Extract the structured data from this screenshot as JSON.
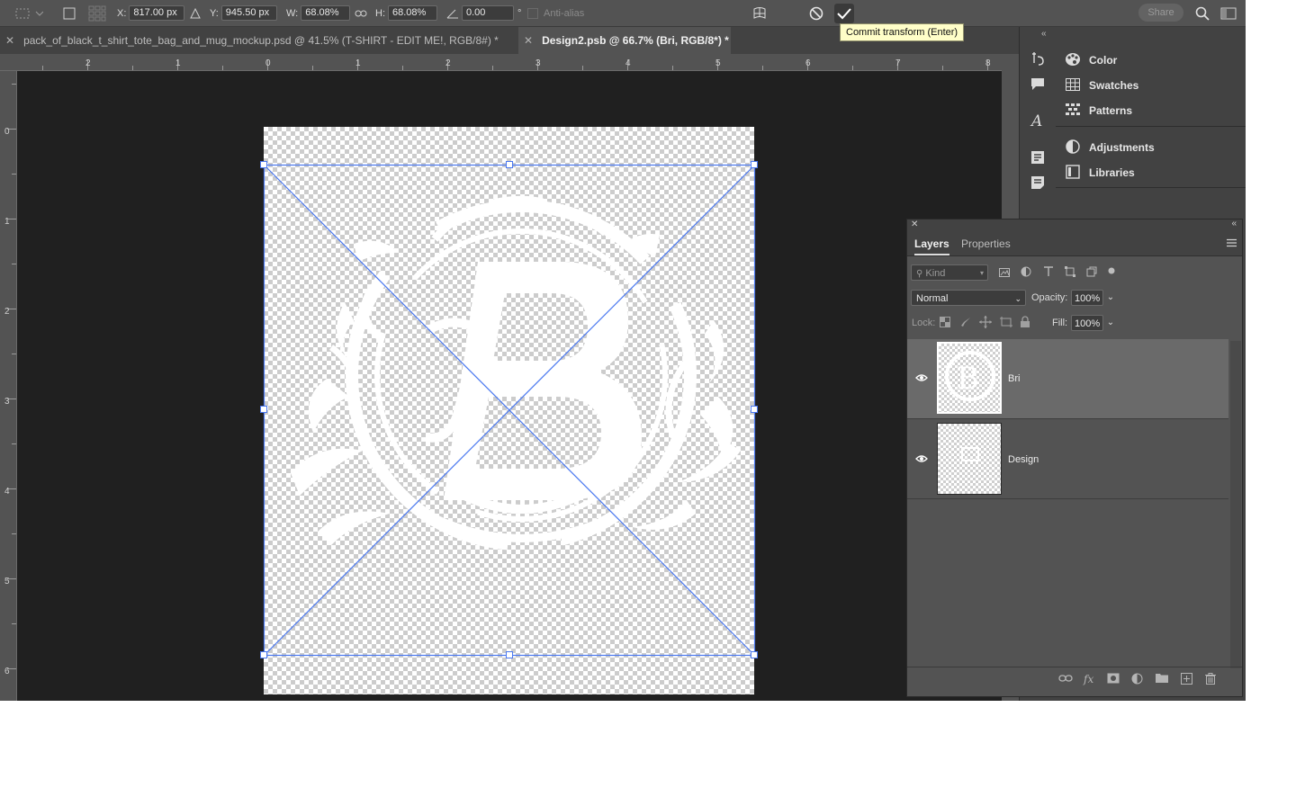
{
  "options_bar": {
    "x_label": "X:",
    "x_value": "817.00 px",
    "y_label": "Y:",
    "y_value": "945.50 px",
    "w_label": "W:",
    "w_value": "68.08%",
    "h_label": "H:",
    "h_value": "68.08%",
    "angle_value": "0.00",
    "degree_symbol": "°",
    "antialias_label": "Anti-alias",
    "share_label": "Share",
    "commit_tooltip": "Commit transform (Enter)"
  },
  "tabs": [
    {
      "label": "pack_of_black_t_shirt_tote_bag_and_mug_mockup.psd @ 41.5% (T-SHIRT - EDIT ME!, RGB/8#) *",
      "active": false
    },
    {
      "label": "Design2.psb @ 66.7% (Bri, RGB/8*) *",
      "active": true
    }
  ],
  "rulers": {
    "top": [
      "2",
      "1",
      "0",
      "1",
      "2",
      "3",
      "4",
      "5",
      "6",
      "7",
      "8"
    ],
    "left": [
      "0",
      "1",
      "2",
      "3",
      "4",
      "5",
      "6"
    ]
  },
  "side_panels": {
    "group1": [
      "Color",
      "Swatches",
      "Patterns"
    ],
    "group2": [
      "Adjustments",
      "Libraries"
    ]
  },
  "layers_panel": {
    "tabs": [
      "Layers",
      "Properties"
    ],
    "filter_placeholder": "Kind",
    "blend_mode": "Normal",
    "opacity_label": "Opacity:",
    "opacity_value": "100%",
    "lock_label": "Lock:",
    "fill_label": "Fill:",
    "fill_value": "100%",
    "layers": [
      {
        "name": "Bri",
        "selected": true,
        "visible": true
      },
      {
        "name": "Design",
        "selected": false,
        "visible": true
      }
    ]
  },
  "colors": {
    "transform_line": "#4a78f0",
    "canvas_bg": "#202020",
    "tooltip_bg": "#fffec8"
  }
}
